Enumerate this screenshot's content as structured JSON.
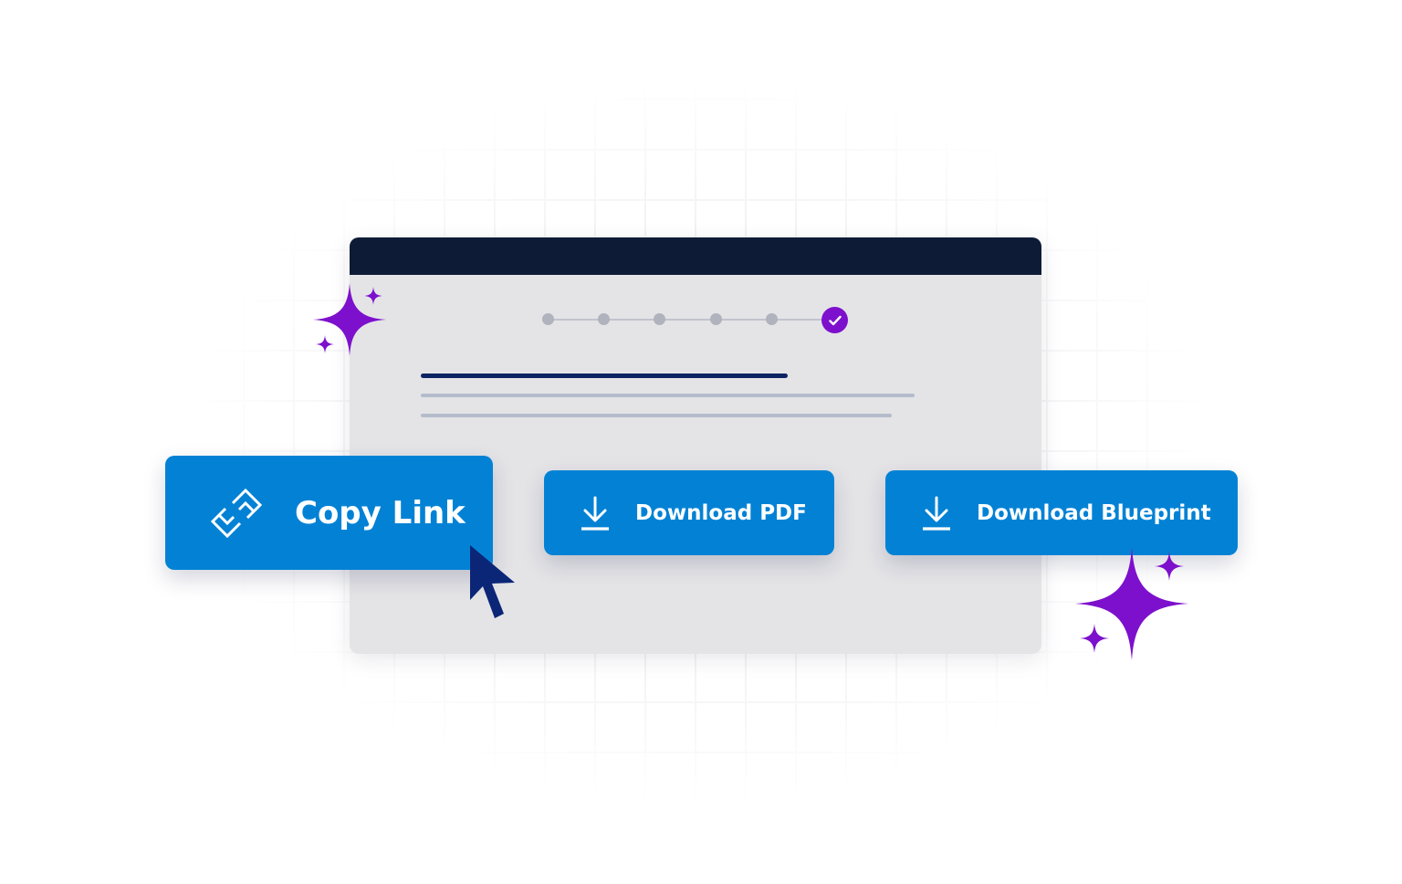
{
  "colors": {
    "button_blue": "#0382d5",
    "titlebar_navy": "#0e1b36",
    "window_gray": "#e4e4e7",
    "accent_purple": "#7d10cc",
    "cursor_navy": "#0b2677",
    "step_gray": "#b0b2bd",
    "heading_line": "#0b2462",
    "text_line": "#b4bccc"
  },
  "stepper": {
    "steps_total": 6,
    "completed_step": 6
  },
  "buttons": {
    "copy_link": {
      "label": "Copy Link",
      "icon": "link-icon"
    },
    "download_pdf": {
      "label": "Download PDF",
      "icon": "download-icon"
    },
    "download_blueprint": {
      "label": "Download Blueprint",
      "icon": "download-icon"
    }
  },
  "decorations": {
    "sparkle_icon": "sparkle-icon",
    "cursor_icon": "mouse-pointer-icon"
  }
}
